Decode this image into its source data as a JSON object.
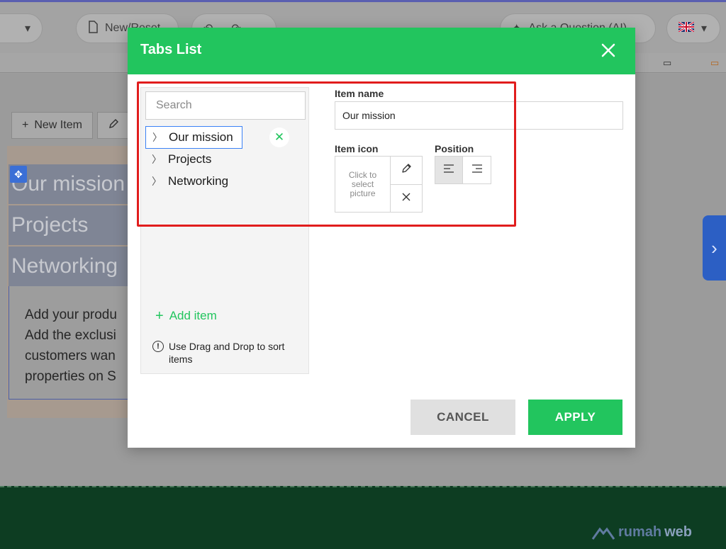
{
  "background": {
    "toolbar": {
      "page_selector_caret": "▾",
      "new_reset_label": "New/Reset",
      "ask_question_label": "Ask a Question (AI)",
      "language_caret": "▾"
    },
    "tabs_toolbar": {
      "new_item_label": "New Item"
    },
    "tabs": [
      "Our mission",
      "Projects",
      "Networking"
    ],
    "content_lines": [
      "Add your produ",
      "Add the exclusi",
      "customers wan",
      "properties on S"
    ],
    "watermark": {
      "brand_a": "rumah",
      "brand_b": "web"
    }
  },
  "modal": {
    "title": "Tabs List",
    "search": {
      "placeholder": "Search",
      "value": ""
    },
    "items": [
      {
        "label": "Our mission",
        "selected": true
      },
      {
        "label": "Projects",
        "selected": false
      },
      {
        "label": "Networking",
        "selected": false
      }
    ],
    "add_item_label": "Add item",
    "hint": "Use Drag and Drop to sort items",
    "item_name_label": "Item name",
    "item_name_value": "Our mission",
    "item_icon_label": "Item icon",
    "icon_picker_text": "Click to select picture",
    "position_label": "Position",
    "position_selected": "left",
    "cancel_label": "CANCEL",
    "apply_label": "APPLY"
  },
  "colors": {
    "accent_green": "#22c55e",
    "highlight_red": "#e11d1d",
    "selection_blue": "#3b82f6",
    "footer_green": "#0d3d22"
  }
}
